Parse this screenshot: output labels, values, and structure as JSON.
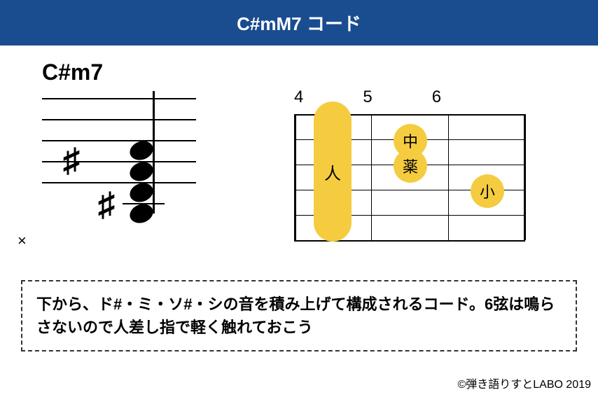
{
  "header": {
    "title": "C#mM7 コード"
  },
  "notation": {
    "chord_name": "C#m7",
    "notes": [
      "C#",
      "E",
      "G#",
      "B"
    ]
  },
  "fretboard": {
    "frets": [
      "4",
      "5",
      "6"
    ],
    "mute_mark": "×",
    "fingers": {
      "barre": {
        "label": "人",
        "fret": 4,
        "strings": "1-5"
      },
      "middle": {
        "label": "中",
        "fret": 5,
        "string": 2
      },
      "ring": {
        "label": "薬",
        "fret": 5,
        "string": 3
      },
      "pinky": {
        "label": "小",
        "fret": 6,
        "string": 4
      }
    }
  },
  "description": {
    "text": "下から、ド#・ミ・ソ#・シの音を積み上げて構成されるコード。6弦は鳴らさないので人差し指で軽く触れておこう"
  },
  "copyright": {
    "text": "©弾き語りすとLABO 2019"
  },
  "colors": {
    "header_bg": "#1a4d8f",
    "finger_dot": "#f5cc3f"
  }
}
